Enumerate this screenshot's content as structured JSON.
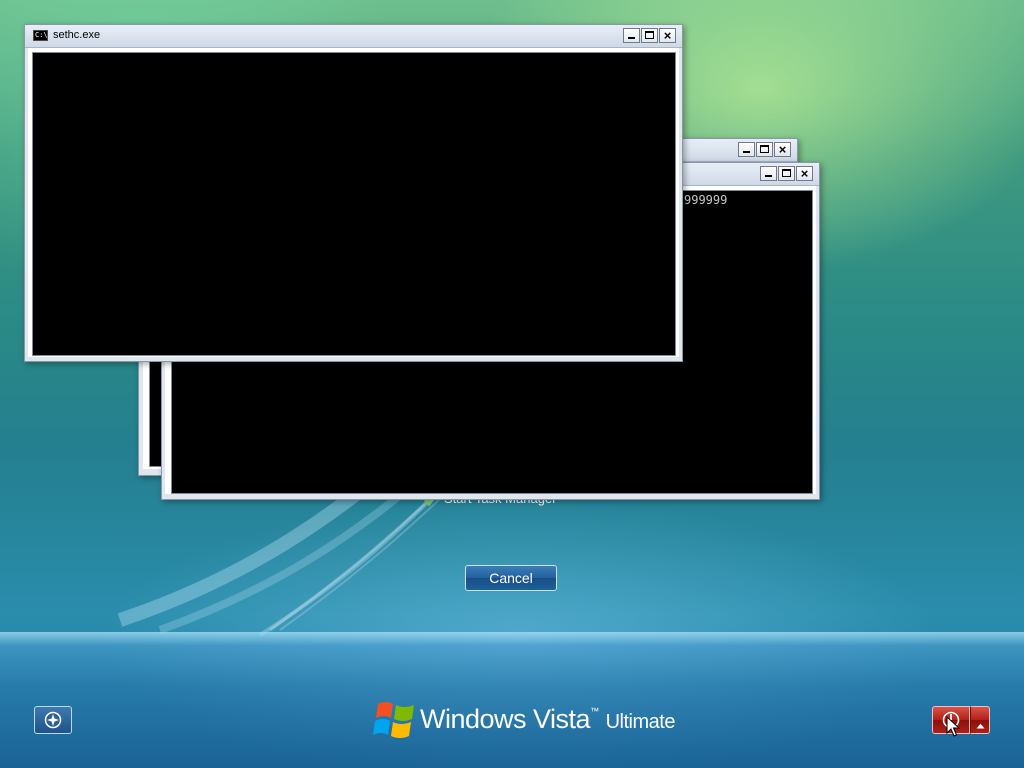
{
  "windows": {
    "front": {
      "title": "sethc.exe",
      "icon": "console-icon"
    },
    "middle": {
      "partial_text": "999999"
    },
    "back": {}
  },
  "task_manager": {
    "label": "Start Task Manager",
    "icon": "task-manager-icon"
  },
  "cancel": {
    "label": "Cancel"
  },
  "ease_of_access": {
    "icon": "ease-of-access-icon"
  },
  "branding": {
    "product": "Windows Vista",
    "tm": "™",
    "edition": "Ultimate"
  },
  "shutdown": {
    "icon": "power-icon",
    "options_icon": "arrow-up-icon"
  },
  "colors": {
    "console_bg": "#000000",
    "shutdown_red": "#b41f17",
    "button_blue": "#22609c"
  }
}
